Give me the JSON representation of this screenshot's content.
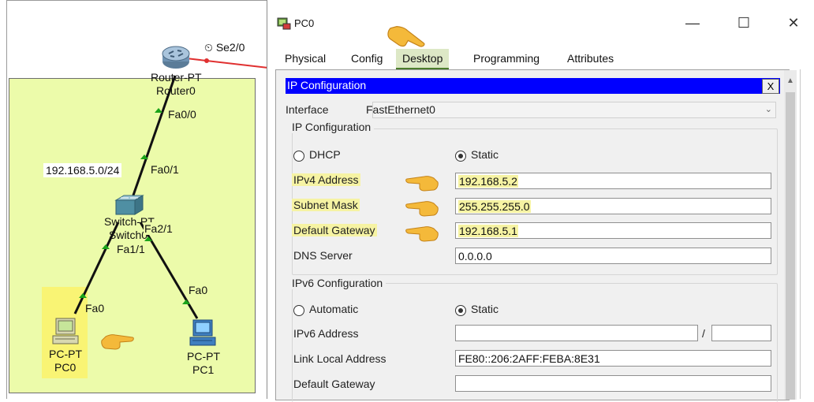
{
  "topology": {
    "router": {
      "type": "Router-PT",
      "name": "Router0",
      "serial_port": "Se2/0",
      "fa_port": "Fa0/0"
    },
    "switch": {
      "type": "Switch-PT",
      "name": "Switch0",
      "uplink_port": "Fa0/1",
      "port_a": "Fa1/1",
      "port_b": "Fa2/1"
    },
    "network_label": "192.168.5.0/24",
    "pc0": {
      "type": "PC-PT",
      "name": "PC0",
      "port": "Fa0"
    },
    "pc1": {
      "type": "PC-PT",
      "name": "PC1",
      "port": "Fa0"
    },
    "clock_symbol": "⏲"
  },
  "window": {
    "title": "PC0",
    "minimize": "—",
    "maximize": "☐",
    "close": "✕"
  },
  "tabs": [
    {
      "label": "Physical",
      "active": false
    },
    {
      "label": "Config",
      "active": false
    },
    {
      "label": "Desktop",
      "active": true
    },
    {
      "label": "Programming",
      "active": false
    },
    {
      "label": "Attributes",
      "active": false
    }
  ],
  "ip_config": {
    "header": "IP Configuration",
    "close_label": "X",
    "interface_label": "Interface",
    "interface_value": "FastEthernet0",
    "ipv4_section": "IP Configuration",
    "dhcp_label": "DHCP",
    "static_label": "Static",
    "mode": "static",
    "ipv4_label": "IPv4 Address",
    "ipv4_value": "192.168.5.2",
    "mask_label": "Subnet Mask",
    "mask_value": "255.255.255.0",
    "gateway_label": "Default Gateway",
    "gateway_value": "192.168.5.1",
    "dns_label": "DNS Server",
    "dns_value": "0.0.0.0",
    "ipv6_section": "IPv6 Configuration",
    "automatic_label": "Automatic",
    "ipv6_static_label": "Static",
    "ipv6_mode": "static",
    "ipv6_address_label": "IPv6 Address",
    "ipv6_address_value": "",
    "prefix_sep": "/",
    "prefix_value": "",
    "link_local_label": "Link Local Address",
    "link_local_value": "FE80::206:2AFF:FEBA:8E31",
    "ipv6_gateway_label": "Default Gateway",
    "ipv6_gateway_value": ""
  },
  "colors": {
    "header_blue": "#0000ff",
    "cluster_green": "#ecfbaa",
    "highlight_yellow": "#f6f3a3",
    "link_green": "#1aa31a",
    "serial_red": "#e03030",
    "cable_black": "#111111"
  }
}
